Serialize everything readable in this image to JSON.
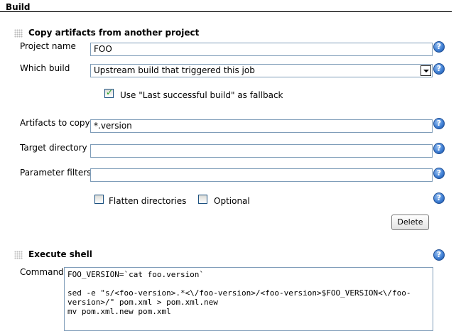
{
  "section": {
    "title": "Build"
  },
  "copy_artifacts": {
    "title": "Copy artifacts from another project",
    "project_name": {
      "label": "Project name",
      "value": "FOO"
    },
    "which_build": {
      "label": "Which build",
      "value": "Upstream build that triggered this job"
    },
    "fallback": {
      "label": "Use \"Last successful build\" as fallback",
      "checked": true
    },
    "artifacts": {
      "label": "Artifacts to copy",
      "value": "*.version"
    },
    "target_dir": {
      "label": "Target directory",
      "value": ""
    },
    "param_filters": {
      "label": "Parameter filters",
      "value": ""
    },
    "flatten": {
      "label": "Flatten directories",
      "checked": false
    },
    "optional": {
      "label": "Optional",
      "checked": false
    },
    "delete_label": "Delete"
  },
  "execute_shell": {
    "title": "Execute shell",
    "command_label": "Command",
    "command_value": "FOO_VERSION=`cat foo.version`\n\nsed -e \"s/<foo-version>.*<\\/foo-version>/<foo-version>$FOO_VERSION<\\/foo-version>/\" pom.xml > pom.xml.new\nmv pom.xml.new pom.xml"
  },
  "icons": {
    "help": "help-icon",
    "grip": "drag-grip-icon",
    "dropdown": "chevron-down-icon"
  },
  "colors": {
    "input_border": "#7f9db9",
    "help_blue": "#3f7fd4"
  }
}
